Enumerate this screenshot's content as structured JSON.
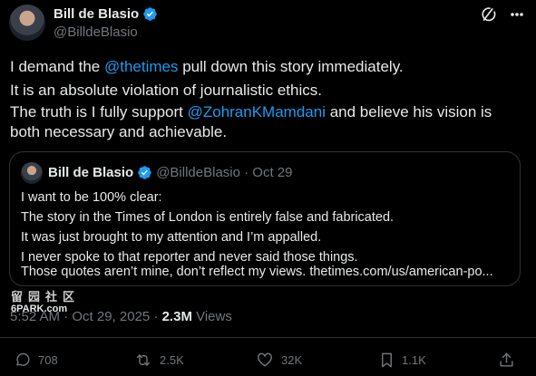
{
  "author": {
    "name": "Bill de Blasio",
    "handle": "@BilldeBlasio"
  },
  "tweet": {
    "line1_pre": "I demand the ",
    "line1_mention": "@thetimes",
    "line1_post": " pull down this story immediately.",
    "line2": "It is an absolute violation of journalistic ethics.",
    "line3_pre": "The truth is I fully support ",
    "line3_mention": "@ZohranKMamdani",
    "line3_post": " and believe his vision is",
    "line4": "both necessary and achievable."
  },
  "quote": {
    "name": "Bill de Blasio",
    "handle_date": "@BilldeBlasio · Oct 29",
    "lines": [
      "I want to be 100% clear:",
      "The story in the Times of London is entirely false and fabricated.",
      "It was just brought to my attention and I’m appalled.",
      "I never spoke to that reporter and never said those things.",
      "Those quotes aren’t mine, don’t reflect my views. thetimes.com/us/american-po..."
    ]
  },
  "meta": {
    "time": "5:52 AM · Oct 29, 2025 · ",
    "views_count": "2.3M",
    "views_label": " Views"
  },
  "watermark": {
    "cjk": "留园社区",
    "site": "6PARK.com"
  },
  "actions": {
    "replies": "708",
    "reposts": "2.5K",
    "likes": "32K",
    "bookmarks": "1.1K"
  },
  "colors": {
    "background": "#000000",
    "text": "#e7e9ea",
    "muted": "#71767b",
    "accent": "#1d9bf0",
    "border": "#2f3336"
  }
}
